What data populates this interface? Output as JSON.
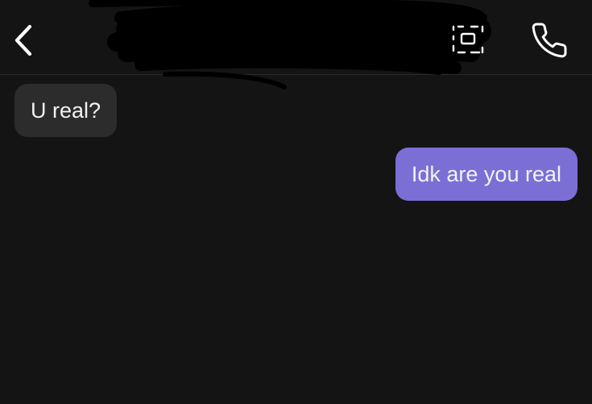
{
  "header": {
    "back_icon": "chevron-left-icon",
    "video_icon": "video-call-icon",
    "call_icon": "phone-icon",
    "contact_name_redacted": true
  },
  "messages": [
    {
      "direction": "incoming",
      "text": "U real?"
    },
    {
      "direction": "outgoing",
      "text": "Idk are you real"
    }
  ],
  "colors": {
    "background": "#141414",
    "incoming_bubble": "#2c2c2c",
    "outgoing_bubble": "#7b6fd6",
    "text": "#f2f2f2"
  }
}
